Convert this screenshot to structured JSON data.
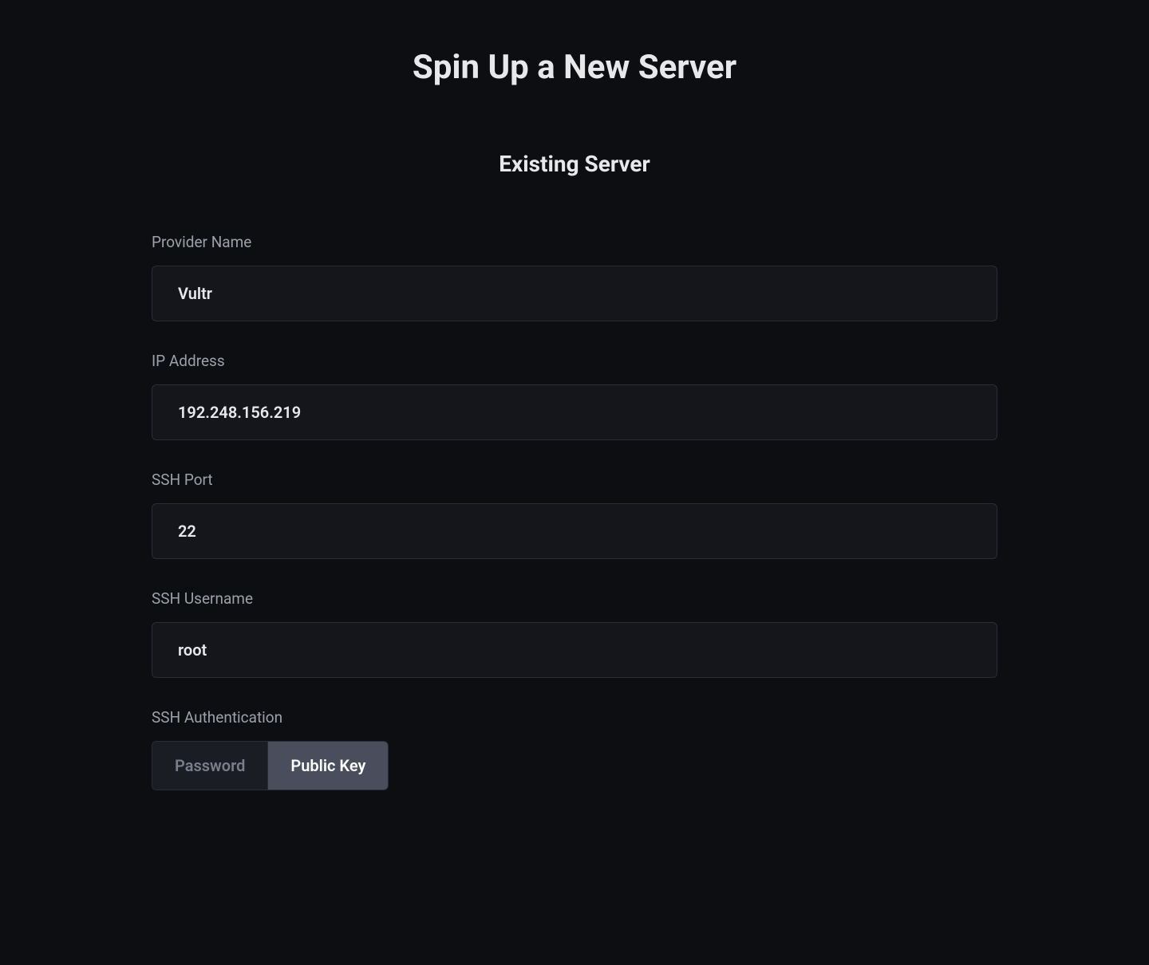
{
  "header": {
    "title": "Spin Up a New Server",
    "subtitle": "Existing Server"
  },
  "form": {
    "provider_name": {
      "label": "Provider Name",
      "value": "Vultr"
    },
    "ip_address": {
      "label": "IP Address",
      "value": "192.248.156.219"
    },
    "ssh_port": {
      "label": "SSH Port",
      "value": "22"
    },
    "ssh_username": {
      "label": "SSH Username",
      "value": "root"
    },
    "ssh_auth": {
      "label": "SSH Authentication",
      "options": {
        "password": "Password",
        "public_key": "Public Key"
      },
      "selected": "public_key"
    }
  }
}
